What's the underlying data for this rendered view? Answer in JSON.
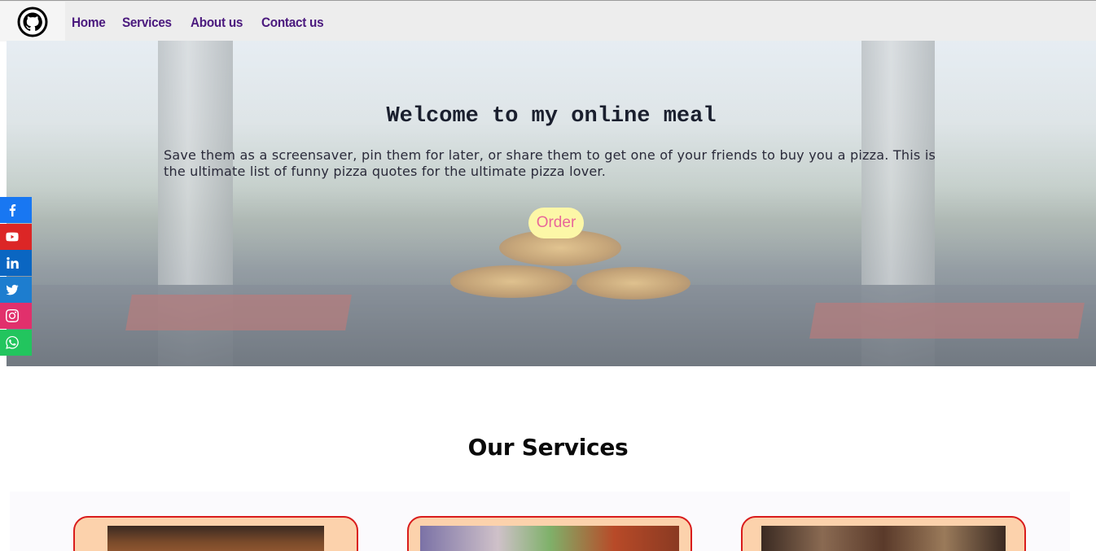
{
  "nav": {
    "logo_icon": "github-icon",
    "links": [
      "Home",
      "Services",
      "About us",
      "Contact us"
    ]
  },
  "hero": {
    "title": "Welcome to my online meal",
    "text": "Save them as a screensaver, pin them for later, or share them to get one of your friends to buy you a pizza. This is the ultimate list of funny pizza quotes for the ultimate pizza lover.",
    "order_label": "Order"
  },
  "social": [
    {
      "name": "facebook-icon",
      "color": "#1877f2"
    },
    {
      "name": "youtube-icon",
      "color": "#dc2626"
    },
    {
      "name": "linkedin-icon",
      "color": "#0a66c2"
    },
    {
      "name": "twitter-icon",
      "color": "#1d7dcf"
    },
    {
      "name": "instagram-icon",
      "color": "#e1306c"
    },
    {
      "name": "whatsapp-icon",
      "color": "#22c55e"
    }
  ],
  "services": {
    "title": "Our Services"
  },
  "colors": {
    "nav_link": "#4b1a7e",
    "order_bg": "#fcf7a7",
    "order_text": "#e8679a",
    "card_bg": "#fcd2ac",
    "card_border": "#d91c1c"
  }
}
